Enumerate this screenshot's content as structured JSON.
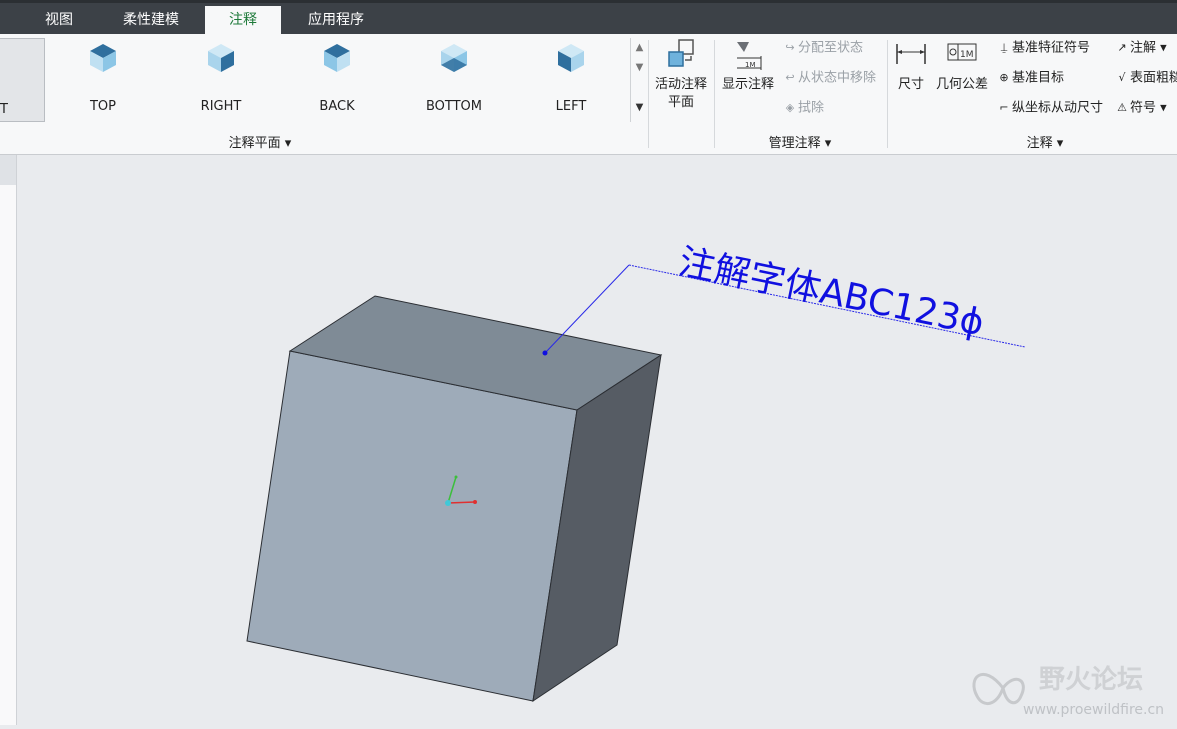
{
  "tabs": [
    {
      "label": "视图"
    },
    {
      "label": "柔性建模"
    },
    {
      "label": "注释"
    },
    {
      "label": "应用程序"
    }
  ],
  "gallery": {
    "first_partial_label": "T",
    "views": [
      {
        "label": "TOP"
      },
      {
        "label": "RIGHT"
      },
      {
        "label": "BACK"
      },
      {
        "label": "BOTTOM"
      },
      {
        "label": "LEFT"
      }
    ],
    "group_label": "注释平面"
  },
  "active_plane": {
    "label_line1": "活动注释",
    "label_line2": "平面"
  },
  "manage": {
    "show_label": "显示注释",
    "assign_state": "分配至状态",
    "remove_state": "从状态中移除",
    "erase": "拭除",
    "group_label": "管理注释"
  },
  "annotation": {
    "dimension": "尺寸",
    "gtol": "几何公差",
    "datum_feature": "基准特征符号",
    "datum_target": "基准目标",
    "ordinate": "纵坐标从动尺寸",
    "note": "注解",
    "surface_finish": "表面粗糙",
    "symbol": "符号",
    "group_label": "注释"
  },
  "model": {
    "note_text": "注解字体ABC123ϕ",
    "note_color": "#1010e0"
  },
  "watermark": {
    "title": "野火论坛",
    "url": "www.proewildfire.cn"
  },
  "colors": {
    "ribbon_bg": "#f7f8f9",
    "tabbar_bg": "#3c4147",
    "active_tab_text": "#1e7a3a",
    "cube_front": "#9eabb9",
    "cube_top": "#7f8b96",
    "cube_right": "#565c64"
  }
}
